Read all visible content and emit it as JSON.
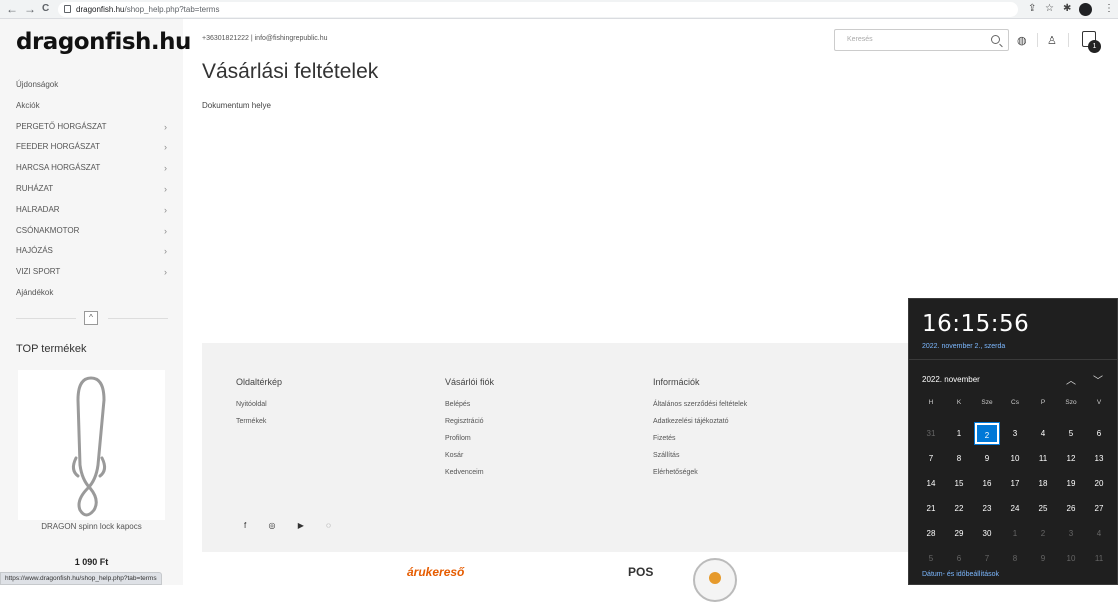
{
  "browser": {
    "back": "←",
    "forward": "→",
    "reload": "C",
    "url_domain": "dragonfish.hu",
    "url_path": "/shop_help.php?tab=terms",
    "status_url": "https://www.dragonfish.hu/shop_help.php?tab=terms"
  },
  "site": {
    "logo": "dragonfish.hu",
    "contact": "+36301821222 | info@fishingrepublic.hu",
    "search_placeholder": "Keresés",
    "cart_count": "1"
  },
  "sidebar": {
    "items": [
      {
        "label": "Újdonságok",
        "has_submenu": false
      },
      {
        "label": "Akciók",
        "has_submenu": false
      },
      {
        "label": "PERGETŐ HORGÁSZAT",
        "has_submenu": true
      },
      {
        "label": "FEEDER HORGÁSZAT",
        "has_submenu": true
      },
      {
        "label": "HARCSA HORGÁSZAT",
        "has_submenu": true
      },
      {
        "label": "RUHÁZAT",
        "has_submenu": true
      },
      {
        "label": "HALRADAR",
        "has_submenu": true
      },
      {
        "label": "CSÓNAKMOTOR",
        "has_submenu": true
      },
      {
        "label": "HAJÓZÁS",
        "has_submenu": true
      },
      {
        "label": "VIZI SPORT",
        "has_submenu": true
      },
      {
        "label": "Ajándékok",
        "has_submenu": false
      }
    ],
    "chevron": "›",
    "up": "^",
    "top_title": "TOP termékek",
    "product_name": "DRAGON spinn lock kapocs",
    "product_price": "1 090 Ft"
  },
  "main": {
    "title": "Vásárlási feltételek",
    "doc_text": "Dokumentum helye"
  },
  "footer": {
    "columns": [
      {
        "heading": "Oldaltérkép",
        "links": [
          "Nyitóoldal",
          "Termékek"
        ]
      },
      {
        "heading": "Vásárlói fiók",
        "links": [
          "Belépés",
          "Regisztráció",
          "Profilom",
          "Kosár",
          "Kedvenceim"
        ]
      },
      {
        "heading": "Információk",
        "links": [
          "Általános szerződési feltételek",
          "Adatkezelési tájékoztató",
          "Fizetés",
          "Szállítás",
          "Elérhetőségek"
        ]
      }
    ],
    "social": [
      "f",
      "◎",
      "▶",
      "◌"
    ],
    "badge_arukereso": "árukereső",
    "badge_pos": "POS"
  },
  "calendar": {
    "time": "16:15:56",
    "date": "2022. november 2., szerda",
    "month": "2022. november",
    "weekdays": [
      "H",
      "K",
      "Sze",
      "Cs",
      "P",
      "Szo",
      "V"
    ],
    "weeks": [
      [
        "31",
        "1",
        "2",
        "3",
        "4",
        "5",
        "6"
      ],
      [
        "7",
        "8",
        "9",
        "10",
        "11",
        "12",
        "13"
      ],
      [
        "14",
        "15",
        "16",
        "17",
        "18",
        "19",
        "20"
      ],
      [
        "21",
        "22",
        "23",
        "24",
        "25",
        "26",
        "27"
      ],
      [
        "28",
        "29",
        "30",
        "1",
        "2",
        "3",
        "4"
      ],
      [
        "5",
        "6",
        "7",
        "8",
        "9",
        "10",
        "11"
      ]
    ],
    "today": "2",
    "settings_link": "Dátum- és időbeállítások"
  }
}
